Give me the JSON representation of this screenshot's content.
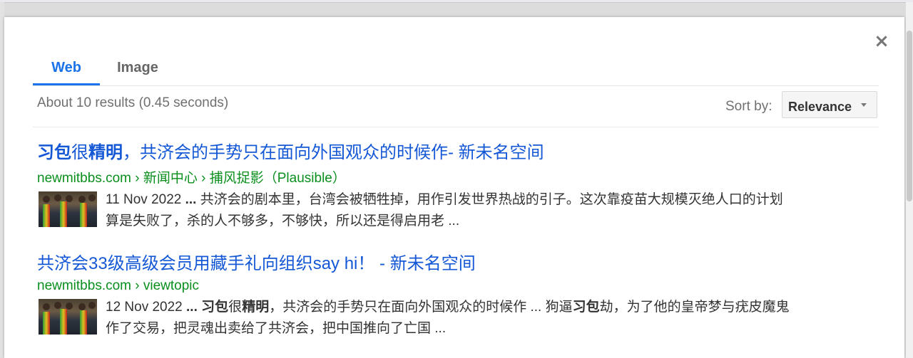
{
  "dialog": {
    "close_label": "×",
    "tabs": [
      {
        "label": "Web"
      },
      {
        "label": "Image"
      }
    ],
    "stats": "About 10 results (0.45 seconds)",
    "sort_label": "Sort by:",
    "sort_value": "Relevance"
  },
  "results": [
    {
      "title_b1": "习包",
      "title_t1": "很",
      "title_b2": "精明",
      "title_t2": "，共济会的手势只在面向外国观众的时候作- 新未名空间",
      "url": "newmitbbs.com › 新闻中心 › 捕风捉影（Plausible）",
      "date": "11 Nov 2022",
      "ellipsis": "...",
      "line1": "共济会的剧本里，台湾会被牺牲掉，用作引发世界热战的引子。这次靠疫苗大规模灭绝人口的计划",
      "line2": "算是失败了，杀的人不够多，不够快，所以还是得启用老 ..."
    },
    {
      "title": "共济会33级高级会员用藏手礼向组织say hi！ - 新未名空间",
      "url": "newmitbbs.com › viewtopic",
      "date": "12 Nov 2022",
      "ellipsis": "...",
      "s1": "习包",
      "s2": "很",
      "s3": "精明",
      "s4": "，共济会的手势只在面向外国观众的时候作 ... 狗逼",
      "s5": "习包",
      "s6": "劫，为了他的皇帝梦与疣皮魔鬼",
      "line2": "作了交易，把灵魂出卖给了共济会，把中国推向了亡国 ..."
    }
  ]
}
